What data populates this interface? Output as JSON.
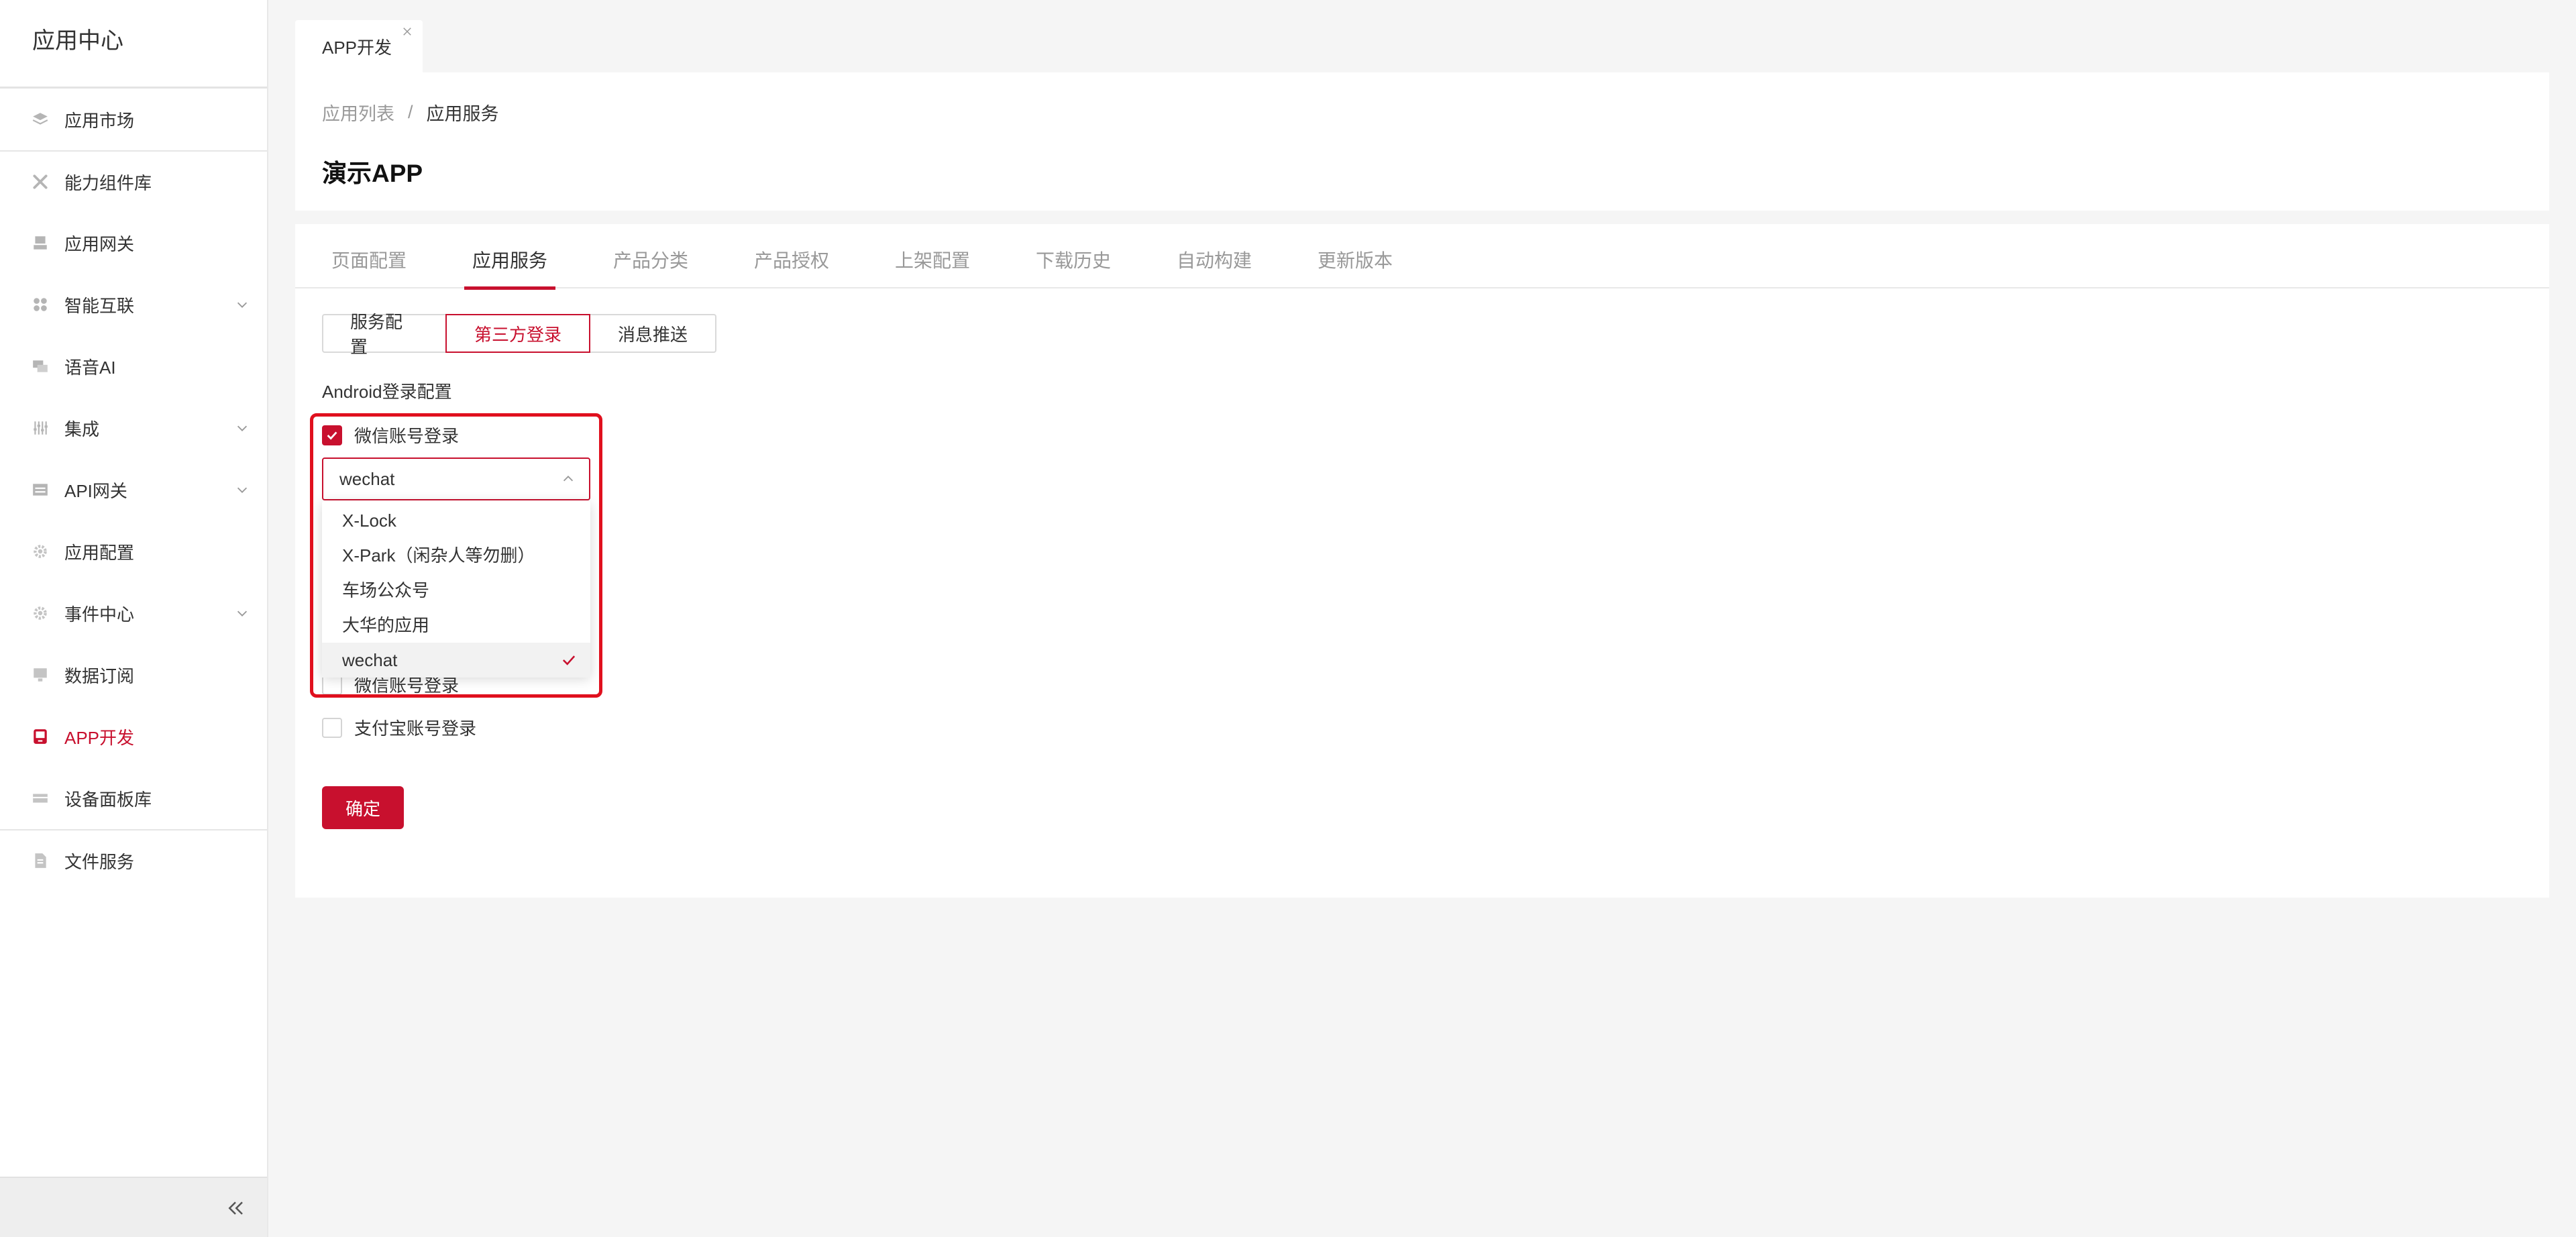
{
  "sidebar": {
    "title": "应用中心",
    "items": [
      {
        "label": "应用市场",
        "icon": "layers-icon"
      },
      {
        "label": "能力组件库",
        "icon": "tools-icon"
      },
      {
        "label": "应用网关",
        "icon": "gateway-icon"
      },
      {
        "label": "智能互联",
        "icon": "grid-icon",
        "expandable": true
      },
      {
        "label": "语音AI",
        "icon": "chat-icon"
      },
      {
        "label": "集成",
        "icon": "sliders-icon",
        "expandable": true
      },
      {
        "label": "API网关",
        "icon": "api-icon",
        "expandable": true
      },
      {
        "label": "应用配置",
        "icon": "gear-icon"
      },
      {
        "label": "事件中心",
        "icon": "gear-icon",
        "expandable": true
      },
      {
        "label": "数据订阅",
        "icon": "monitor-icon"
      },
      {
        "label": "APP开发",
        "icon": "app-icon",
        "active": true
      },
      {
        "label": "设备面板库",
        "icon": "panel-icon"
      },
      {
        "label": "文件服务",
        "icon": "file-icon"
      }
    ],
    "collapse_icon": "double-chevron-left-icon"
  },
  "page_tab": {
    "label": "APP开发",
    "close_icon": "close-icon"
  },
  "header": {
    "breadcrumb": {
      "parent": "应用列表",
      "separator": "/",
      "current": "应用服务"
    },
    "title": "演示APP"
  },
  "tabs": [
    {
      "label": "页面配置"
    },
    {
      "label": "应用服务",
      "active": true
    },
    {
      "label": "产品分类"
    },
    {
      "label": "产品授权"
    },
    {
      "label": "上架配置"
    },
    {
      "label": "下载历史"
    },
    {
      "label": "自动构建"
    },
    {
      "label": "更新版本"
    }
  ],
  "subtabs": [
    {
      "label": "服务配置"
    },
    {
      "label": "第三方登录",
      "active": true
    },
    {
      "label": "消息推送"
    }
  ],
  "form": {
    "section_label": "Android登录配置",
    "wechat_checkbox": {
      "label": "微信账号登录",
      "checked": true
    },
    "select": {
      "value": "wechat",
      "open": true,
      "options": [
        "X-Lock",
        "X-Park（闲杂人等勿删）",
        "车场公众号",
        "大华的应用",
        "wechat"
      ],
      "selected": "wechat"
    },
    "wechat_checkbox_2": {
      "label": "微信账号登录",
      "checked": false
    },
    "alipay_checkbox": {
      "label": "支付宝账号登录",
      "checked": false
    },
    "submit_label": "确定"
  },
  "colors": {
    "accent": "#c8102e",
    "highlight": "#e0101e"
  }
}
